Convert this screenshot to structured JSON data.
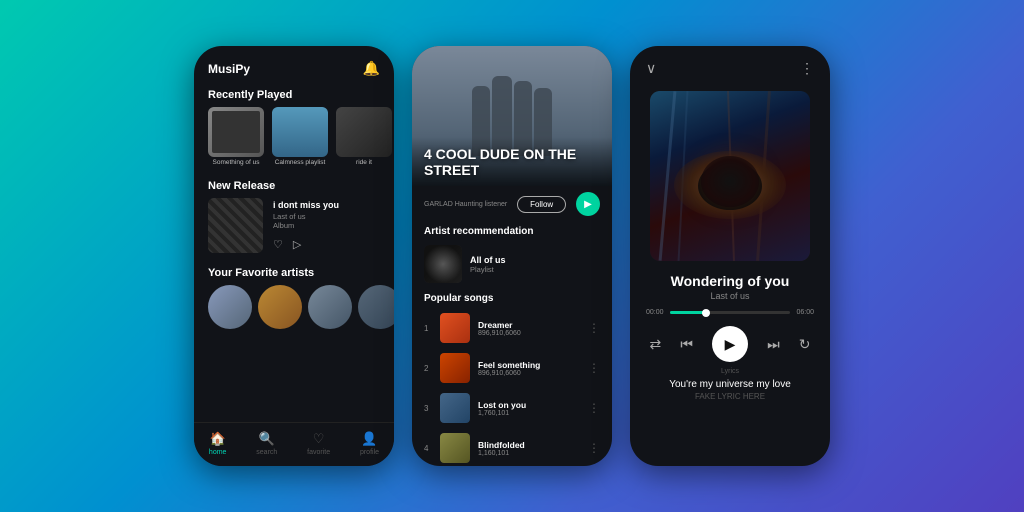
{
  "background": "#00c9b0",
  "phones": {
    "left": {
      "logo": "MusiPy",
      "sections": {
        "recently_played": {
          "title": "Recently Played",
          "albums": [
            {
              "label": "Something of us"
            },
            {
              "label": "Calmness playlist"
            },
            {
              "label": "ride it"
            }
          ]
        },
        "new_release": {
          "title": "New Release",
          "track": {
            "title": "i dont miss you",
            "artist": "Last of us",
            "detail": "Album"
          }
        },
        "favorite_artists": {
          "title": "Your Favorite artists"
        }
      },
      "nav": [
        {
          "icon": "🏠",
          "label": "home",
          "active": true
        },
        {
          "icon": "🔍",
          "label": "search",
          "active": false
        },
        {
          "icon": "♡",
          "label": "favorite",
          "active": false
        },
        {
          "icon": "👤",
          "label": "profile",
          "active": false
        }
      ]
    },
    "center": {
      "band_name": "4 COOL DUDE ON THE STREET",
      "artist_sub": "GARLAD Haunting listener",
      "follow_btn": "Follow",
      "sections": {
        "artist_recommendation": {
          "title": "Artist recommendation",
          "artist": {
            "name": "All of us",
            "type": "Playlist"
          }
        },
        "popular_songs": {
          "title": "Popular songs",
          "songs": [
            {
              "num": "1",
              "title": "Dreamer",
              "meta": "896,910,6060"
            },
            {
              "num": "2",
              "title": "Feel something",
              "meta": "896,910,6060"
            },
            {
              "num": "3",
              "title": "Lost on you",
              "meta": "1,760,101"
            },
            {
              "num": "4",
              "title": "Blindfolded",
              "meta": "1,160,101"
            }
          ]
        }
      }
    },
    "right": {
      "track": {
        "title": "Wondering of you",
        "artist": "Last of us"
      },
      "progress": {
        "current": "00:00",
        "total": "06:00",
        "percent": 30
      },
      "lyrics_label": "Lyrics",
      "lyrics_line1": "You're my universe my love",
      "lyrics_line2": "FAKE LYRIC HERE"
    }
  }
}
